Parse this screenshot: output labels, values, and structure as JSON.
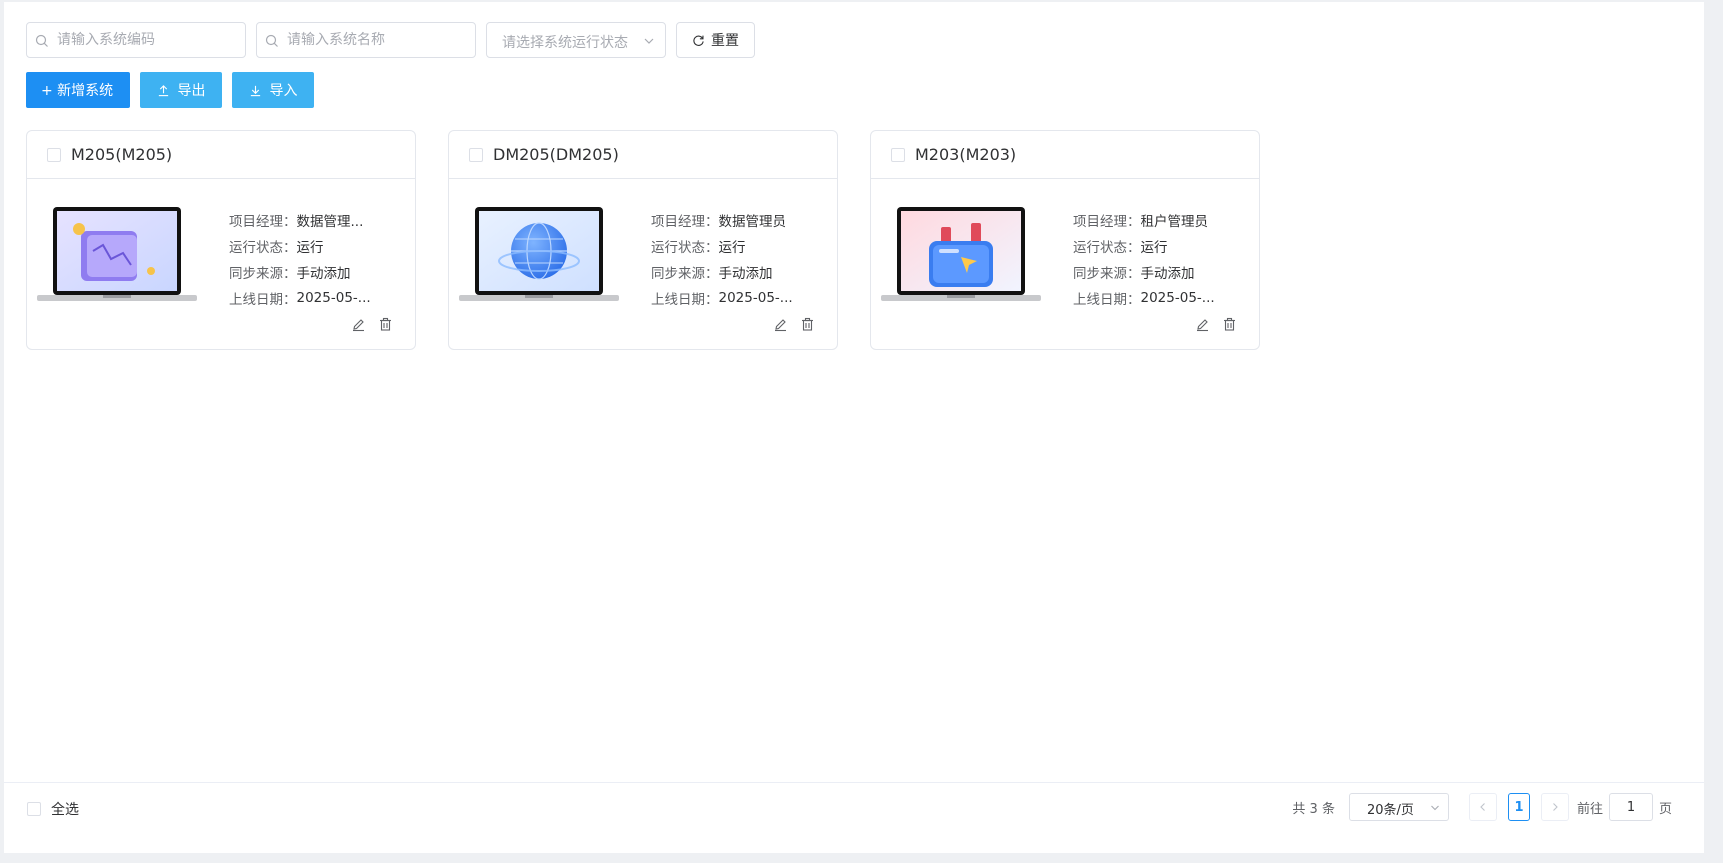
{
  "filters": {
    "code_placeholder": "请输入系统编码",
    "name_placeholder": "请输入系统名称",
    "status_placeholder": "请选择系统运行状态",
    "reset_label": "重置"
  },
  "actions": {
    "add_label": "+ 新增系统",
    "export_label": "导出",
    "import_label": "导入"
  },
  "field_labels": {
    "manager": "项目经理：",
    "status": "运行状态：",
    "source": "同步来源：",
    "date": "上线日期："
  },
  "cards": [
    {
      "title": "M205(M205)",
      "manager": "数据管理...",
      "status": "运行",
      "source": "手动添加",
      "date": "2025-05-...",
      "image_icon": "chart-screen-icon"
    },
    {
      "title": "DM205(DM205)",
      "manager": "数据管理员",
      "status": "运行",
      "source": "手动添加",
      "date": "2025-05-...",
      "image_icon": "globe-screen-icon"
    },
    {
      "title": "M203(M203)",
      "manager": "租户管理员",
      "status": "运行",
      "source": "手动添加",
      "date": "2025-05-...",
      "image_icon": "wallet-screen-icon"
    }
  ],
  "footer": {
    "select_all_label": "全选",
    "total_text": "共 3 条",
    "page_size": "20条/页",
    "current_page": "1",
    "goto_prefix": "前往",
    "goto_value": "1",
    "goto_suffix": "页"
  },
  "colors": {
    "primary": "#1d8ff3",
    "light_button": "#3eb2f2"
  }
}
